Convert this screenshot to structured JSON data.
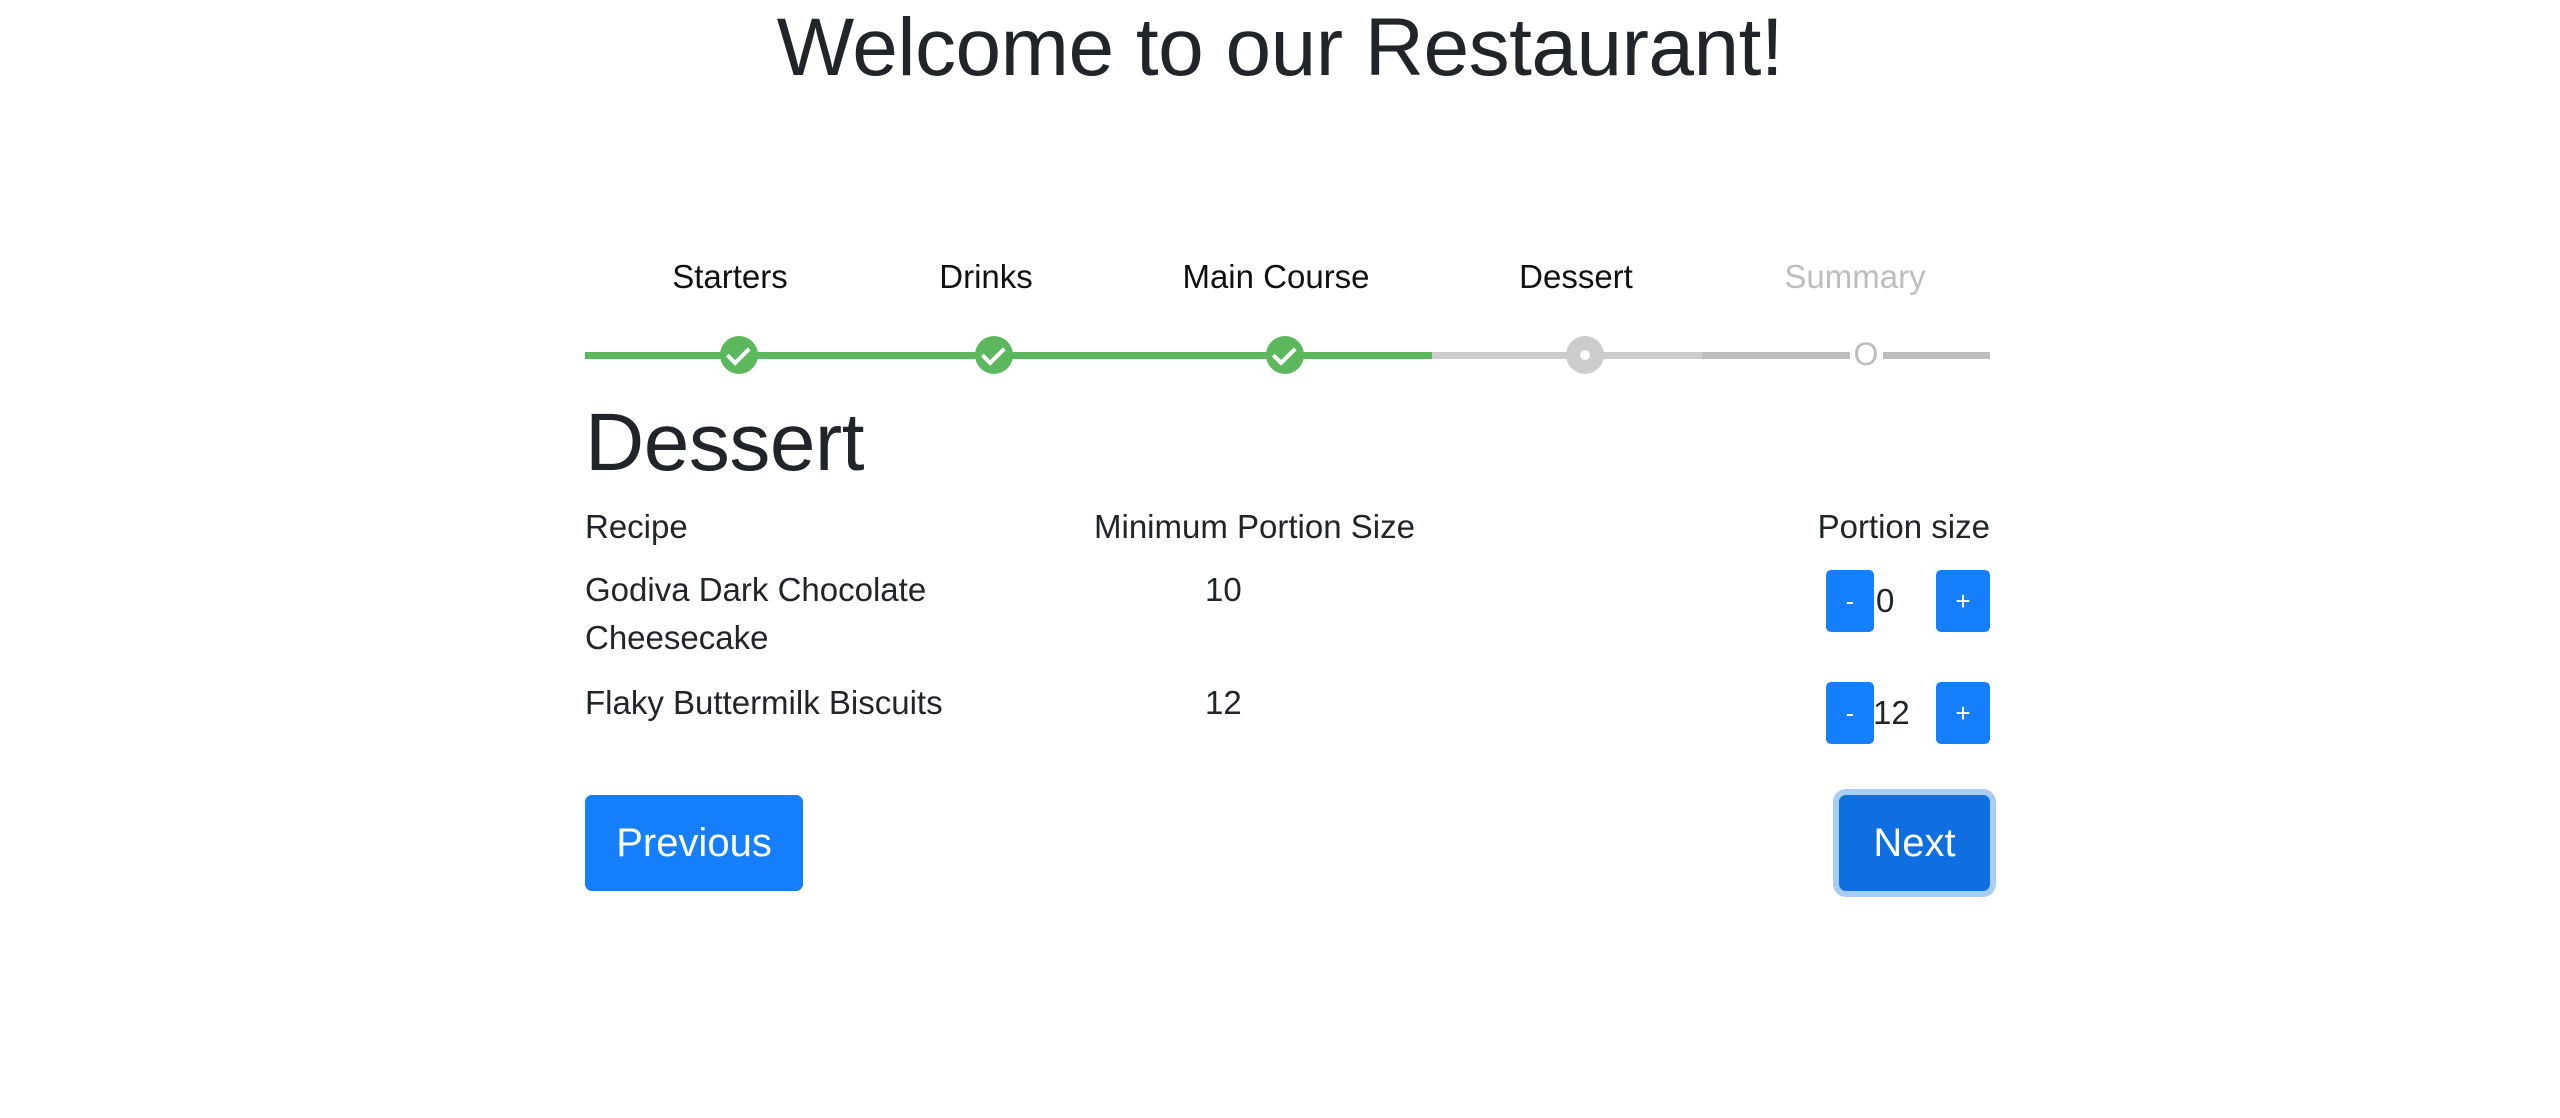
{
  "header": {
    "title": "Welcome to our Restaurant!"
  },
  "stepper": {
    "steps": [
      {
        "label": "Starters",
        "state": "done"
      },
      {
        "label": "Drinks",
        "state": "done"
      },
      {
        "label": "Main Course",
        "state": "done"
      },
      {
        "label": "Dessert",
        "state": "current"
      },
      {
        "label": "Summary",
        "state": "pending",
        "marker": "O"
      }
    ]
  },
  "section": {
    "title": "Dessert",
    "columns": {
      "recipe": "Recipe",
      "min_portion": "Minimum Portion Size",
      "portion": "Portion size"
    },
    "rows": [
      {
        "recipe": "Godiva Dark Chocolate Cheesecake",
        "min_portion": "10",
        "portion": "0"
      },
      {
        "recipe": "Flaky Buttermilk Biscuits",
        "min_portion": "12",
        "portion": "12"
      }
    ],
    "minus_label": "-",
    "plus_label": "+"
  },
  "nav": {
    "previous_label": "Previous",
    "next_label": "Next"
  },
  "colors": {
    "primary": "#157efb",
    "success": "#5cb85c",
    "inactive": "#cccccc"
  }
}
